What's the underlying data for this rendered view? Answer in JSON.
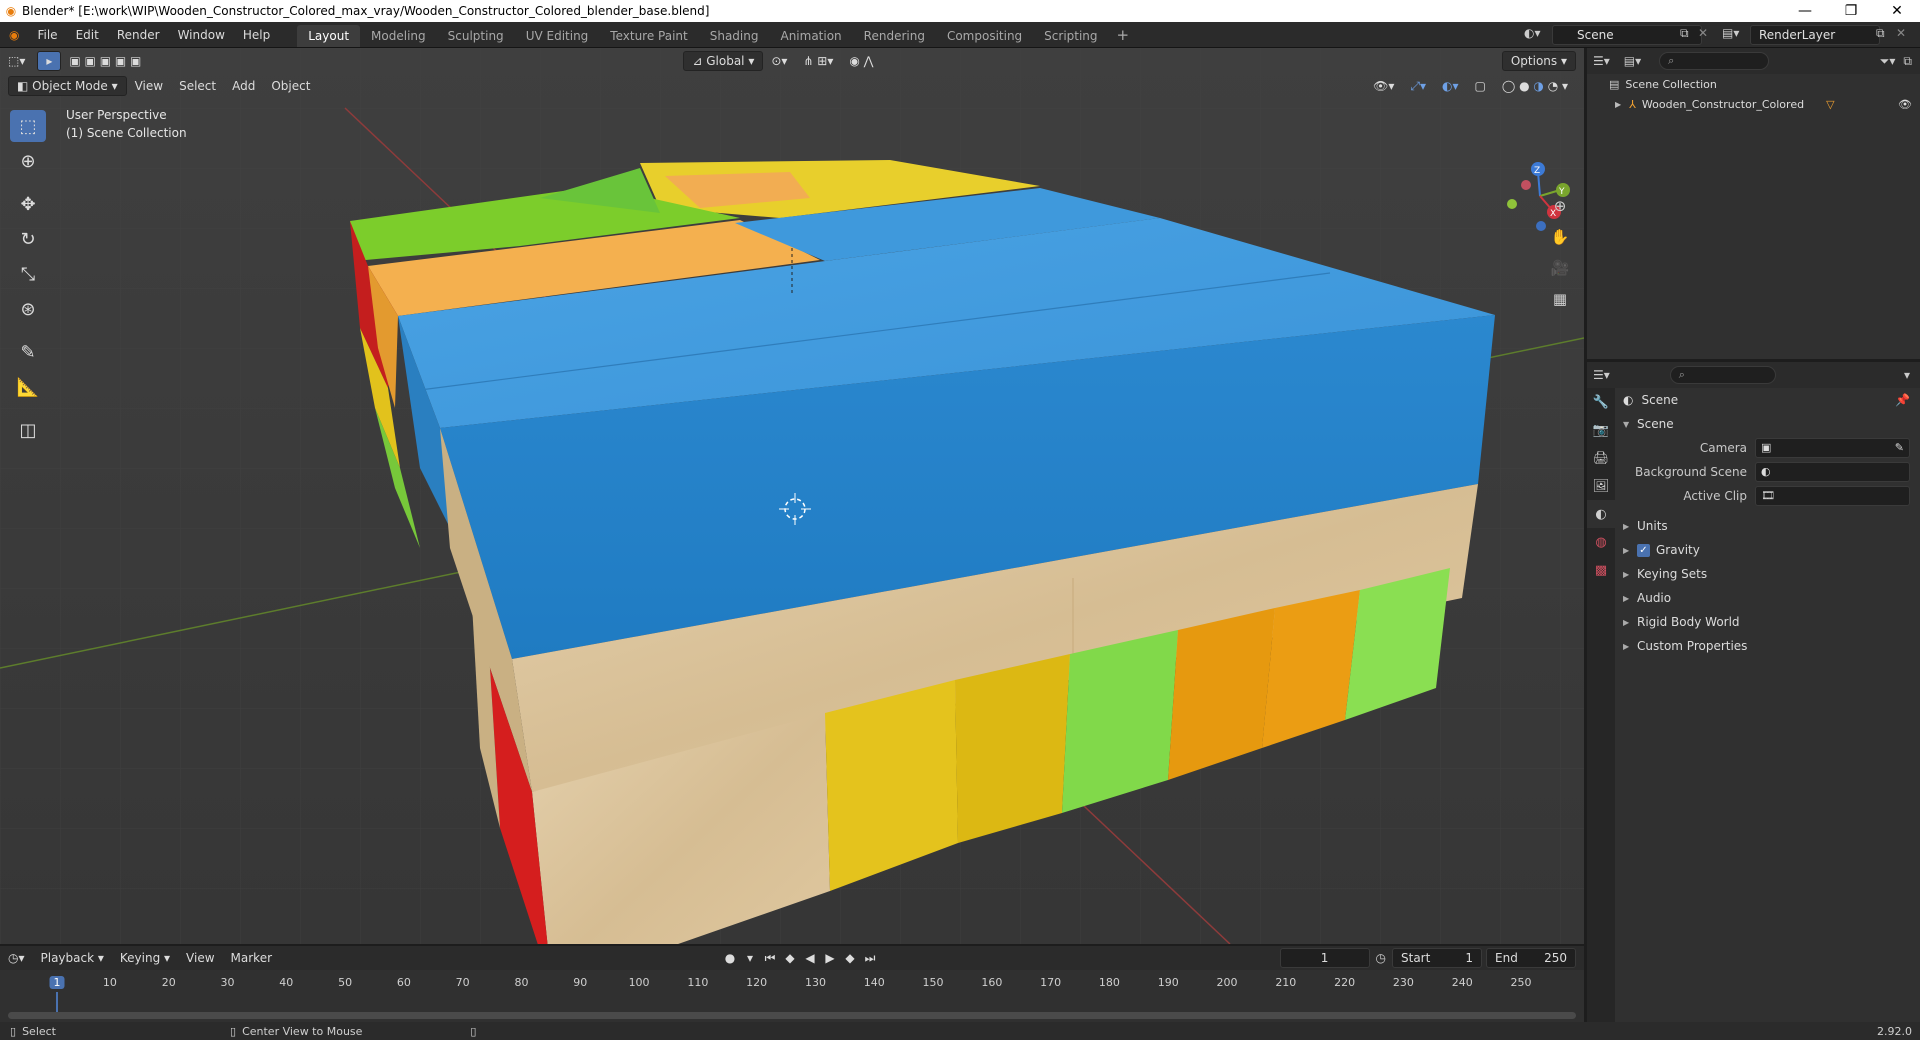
{
  "window": {
    "title": "Blender* [E:\\work\\WIP\\Wooden_Constructor_Colored_max_vray/Wooden_Constructor_Colored_blender_base.blend]",
    "minimize": "—",
    "maximize": "❐",
    "close": "✕"
  },
  "menu": [
    "File",
    "Edit",
    "Render",
    "Window",
    "Help"
  ],
  "workspaces": [
    "Layout",
    "Modeling",
    "Sculpting",
    "UV Editing",
    "Texture Paint",
    "Shading",
    "Animation",
    "Rendering",
    "Compositing",
    "Scripting"
  ],
  "active_workspace": "Layout",
  "scene_name": "Scene",
  "view_layer": "RenderLayer",
  "viewport": {
    "transform_orientation": "Global",
    "options_label": "Options",
    "mode": "Object Mode",
    "header_menus": [
      "View",
      "Select",
      "Add",
      "Object"
    ],
    "perspective_label": "User Perspective",
    "collection_label": "(1) Scene Collection",
    "gizmo_axes": {
      "x": "X",
      "y": "Y",
      "z": "Z"
    }
  },
  "outliner": {
    "root": "Scene Collection",
    "object": "Wooden_Constructor_Colored"
  },
  "properties": {
    "context": "Scene",
    "panel_title": "Scene",
    "fields": [
      {
        "label": "Camera",
        "value": ""
      },
      {
        "label": "Background Scene",
        "value": ""
      },
      {
        "label": "Active Clip",
        "value": ""
      }
    ],
    "subpanels": [
      "Units",
      "Gravity",
      "Keying Sets",
      "Audio",
      "Rigid Body World",
      "Custom Properties"
    ],
    "gravity_enabled": true
  },
  "timeline": {
    "menus": [
      "Playback",
      "Keying",
      "View",
      "Marker"
    ],
    "current_frame": "1",
    "start_label": "Start",
    "start": "1",
    "end_label": "End",
    "end": "250",
    "ticks": [
      "1",
      "10",
      "20",
      "30",
      "40",
      "50",
      "60",
      "70",
      "80",
      "90",
      "100",
      "110",
      "120",
      "130",
      "140",
      "150",
      "160",
      "170",
      "180",
      "190",
      "200",
      "210",
      "220",
      "230",
      "240",
      "250"
    ]
  },
  "status": {
    "left": "Select",
    "middle": "Center View to Mouse",
    "version": "2.92.0"
  },
  "colors": {
    "accent": "#4a72b0",
    "blue_block": "#3d97dc",
    "wood": "#ddc59d",
    "yellow": "#e5c21a",
    "green": "#7ed13b",
    "orange": "#f5ad49",
    "red": "#d51e1e"
  }
}
